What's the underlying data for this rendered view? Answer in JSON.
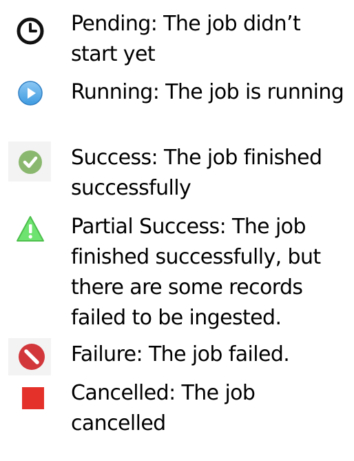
{
  "legend": {
    "items": [
      {
        "status": "Pending",
        "icon": "clock-icon",
        "text": "Pending: The job didn’t start yet",
        "color": "#000000"
      },
      {
        "status": "Running",
        "icon": "play-circle-icon",
        "text": "Running: The job is running",
        "color": "#3f9be0"
      },
      {
        "status": "Success",
        "icon": "check-circle-icon",
        "text": "Success: The job finished successfully",
        "color": "#8bb86f"
      },
      {
        "status": "Partial Success",
        "icon": "warning-triangle-icon",
        "text": "Partial Success: The job finished successfully, but there are some records failed to be ingested.",
        "color": "#6fe36f"
      },
      {
        "status": "Failure",
        "icon": "no-entry-icon",
        "text": "Failure: The job failed.",
        "color": "#d2373c"
      },
      {
        "status": "Cancelled",
        "icon": "square-stop-icon",
        "text": "Cancelled: The job cancelled",
        "color": "#e4322b"
      }
    ]
  }
}
